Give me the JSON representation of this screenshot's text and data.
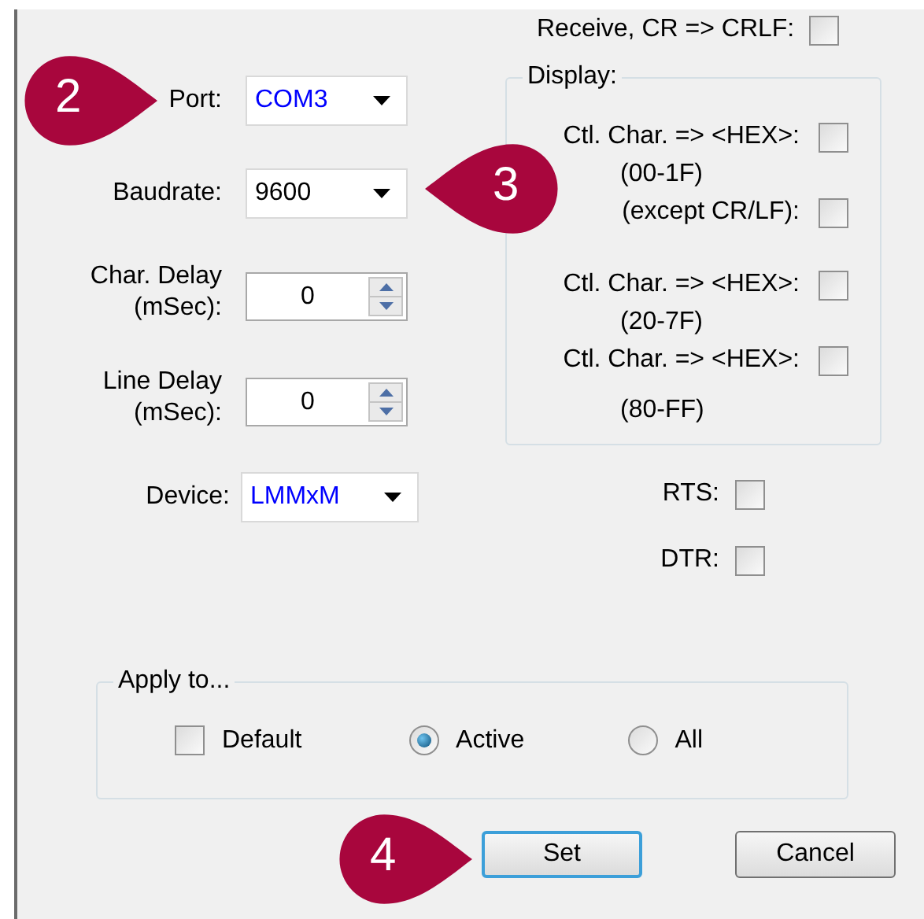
{
  "receive_crlf": {
    "label": "Receive, CR => CRLF:",
    "checked": false
  },
  "fields": [
    {
      "kind": "combo",
      "label": [
        "Port:"
      ],
      "value": "COM3",
      "color": "#0000ff"
    },
    {
      "kind": "combo",
      "label": [
        "Baudrate:"
      ],
      "value": "9600",
      "color": "#000000"
    },
    {
      "kind": "spin",
      "label": [
        "Char. Delay",
        "(mSec):"
      ],
      "value": "0"
    },
    {
      "kind": "spin",
      "label": [
        "Line Delay",
        "(mSec):"
      ],
      "value": "0"
    },
    {
      "kind": "combo",
      "label": [
        "Device:"
      ],
      "value": "LMMxM",
      "color": "#0000ff"
    }
  ],
  "display": {
    "title": "Display:",
    "items": [
      {
        "label": "Ctl. Char. => <HEX>:",
        "checked": false,
        "note": "(00-1F)"
      },
      {
        "label": "(except CR/LF):",
        "checked": false
      },
      {
        "label": "Ctl. Char. => <HEX>:",
        "checked": false,
        "note": "(20-7F)"
      },
      {
        "label": "Ctl. Char. => <HEX>:",
        "checked": false,
        "note": "(80-FF)"
      }
    ]
  },
  "lines": [
    {
      "label": "RTS:",
      "checked": false
    },
    {
      "label": "DTR:",
      "checked": false
    }
  ],
  "apply_to": {
    "title": "Apply to...",
    "options": [
      {
        "kind": "checkbox",
        "label": "Default",
        "checked": false
      },
      {
        "kind": "radio",
        "label": "Active",
        "selected": true
      },
      {
        "kind": "radio",
        "label": "All",
        "selected": false
      }
    ]
  },
  "buttons": [
    {
      "label": "Set",
      "default": true
    },
    {
      "label": "Cancel",
      "default": false
    }
  ],
  "callouts": [
    {
      "number": "2",
      "kind": "right"
    },
    {
      "number": "3",
      "kind": "left"
    },
    {
      "number": "4",
      "kind": "right"
    }
  ]
}
